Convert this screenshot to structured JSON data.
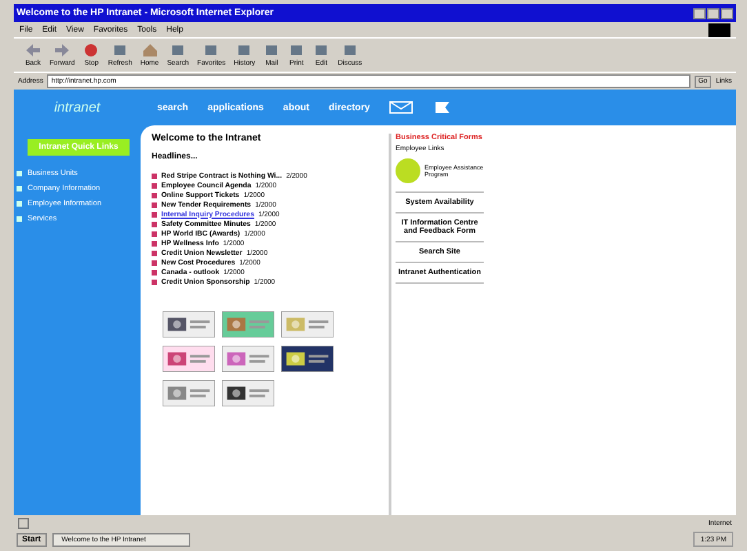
{
  "window": {
    "title": "Welcome to the HP Intranet - Microsoft Internet Explorer"
  },
  "menu": [
    "File",
    "Edit",
    "View",
    "Favorites",
    "Tools",
    "Help"
  ],
  "toolbar": [
    {
      "label": "Back",
      "kind": "back"
    },
    {
      "label": "Forward",
      "kind": "forward"
    },
    {
      "label": "Stop",
      "kind": "stop"
    },
    {
      "label": "Refresh",
      "kind": "refresh"
    },
    {
      "label": "Home",
      "kind": "home"
    },
    {
      "label": "Search",
      "kind": "search"
    },
    {
      "label": "Favorites",
      "kind": "favorites"
    },
    {
      "label": "History",
      "kind": "history"
    },
    {
      "label": "Mail",
      "kind": "mail"
    },
    {
      "label": "Print",
      "kind": "print"
    },
    {
      "label": "Edit",
      "kind": "edit"
    },
    {
      "label": "Discuss",
      "kind": "discuss"
    }
  ],
  "address": {
    "label": "Address",
    "value": "http://intranet.hp.com",
    "go": "Go",
    "links": "Links"
  },
  "site": {
    "logo": "intranet",
    "nav": [
      "search",
      "applications",
      "about",
      "directory"
    ],
    "quick": "Intranet Quick Links",
    "sidebar": [
      "Business Units",
      "Company Information",
      "Employee Information",
      "Services"
    ],
    "heading": "Welcome to the Intranet",
    "subheading": "Headlines...",
    "headlines": [
      {
        "text": "Red Stripe Contract is Nothing Wi...",
        "date": "2/2000",
        "link": false
      },
      {
        "text": "Employee Council Agenda",
        "date": "1/2000",
        "link": false
      },
      {
        "text": "Online Support Tickets",
        "date": "1/2000",
        "link": false
      },
      {
        "text": "New Tender Requirements",
        "date": "1/2000",
        "link": false
      },
      {
        "text": "Internal Inquiry Procedures",
        "date": "1/2000",
        "link": true
      },
      {
        "text": "Safety Committee Minutes",
        "date": "1/2000",
        "link": false
      },
      {
        "text": "HP World IBC (Awards)",
        "date": "1/2000",
        "link": false
      },
      {
        "text": "HP Wellness Info",
        "date": "1/2000",
        "link": false
      },
      {
        "text": "Credit Union Newsletter",
        "date": "1/2000",
        "link": false
      },
      {
        "text": "New Cost Procedures",
        "date": "1/2000",
        "link": false
      },
      {
        "text": "Canada - outlook",
        "date": "1/2000",
        "link": false
      },
      {
        "text": "Credit Union Sponsorship",
        "date": "1/2000",
        "link": false
      }
    ],
    "forms_title": "Business Critical Forms",
    "forms_sub": "Employee Links",
    "program": "Employee Assistance Program",
    "links": [
      "System Availability",
      "IT Information Centre and Feedback Form",
      "Search Site",
      "Intranet Authentication"
    ]
  },
  "status": {
    "zone": "Internet"
  },
  "taskbar": {
    "start": "Start",
    "task": "Welcome to the HP Intranet",
    "clock": "1:23 PM"
  }
}
